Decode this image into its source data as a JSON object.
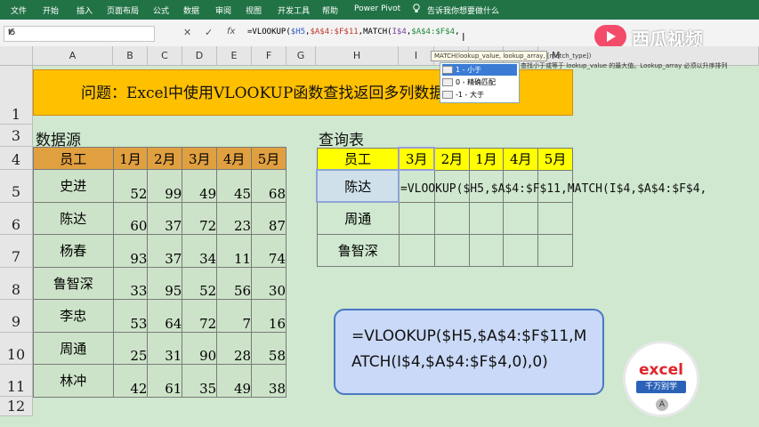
{
  "ribbon": {
    "tabs": [
      "文件",
      "开始",
      "插入",
      "页面布局",
      "公式",
      "数据",
      "审阅",
      "视图",
      "开发工具",
      "帮助",
      "Power Pivot"
    ],
    "tell_me": "告诉我你想要做什么"
  },
  "formula_bar": {
    "name_box": "I5",
    "cancel": "✕",
    "enter": "✓",
    "fx": "fx",
    "p1": "=VLOOKUP(",
    "p2": "$H5",
    "p3": ",",
    "p4": "$A$4:$F$11",
    "p5": ",MATCH(",
    "p6": "I$4",
    "p7": ",",
    "p8": "$A$4:$F$4",
    "p9": ","
  },
  "tooltip": {
    "text": "MATCH(lookup_value, lookup_array, [match_type])"
  },
  "autocomplete": {
    "items": [
      "1 - 小于",
      "0 - 精确匹配",
      "-1 - 大于"
    ],
    "description": "查找小于或等于 lookup_value 的最大值。Lookup_array 必须以升序排列"
  },
  "columns": [
    "A",
    "B",
    "C",
    "D",
    "E",
    "F",
    "G",
    "H",
    "I",
    "J",
    "K",
    "L",
    "M"
  ],
  "rows": [
    "1",
    "3",
    "4",
    "5",
    "6",
    "7",
    "8",
    "9",
    "10",
    "11",
    "12"
  ],
  "question": "问题：Excel中使用VLOOKUP函数查找返回多列数据",
  "source": {
    "title": "数据源",
    "headers": [
      "员工",
      "1月",
      "2月",
      "3月",
      "4月",
      "5月"
    ],
    "rows": [
      [
        "史进",
        "52",
        "99",
        "49",
        "45",
        "68"
      ],
      [
        "陈达",
        "60",
        "37",
        "72",
        "23",
        "87"
      ],
      [
        "杨春",
        "93",
        "37",
        "34",
        "11",
        "74"
      ],
      [
        "鲁智深",
        "33",
        "95",
        "52",
        "56",
        "30"
      ],
      [
        "李忠",
        "53",
        "64",
        "72",
        "7",
        "16"
      ],
      [
        "周通",
        "25",
        "31",
        "90",
        "28",
        "58"
      ],
      [
        "林冲",
        "42",
        "61",
        "35",
        "49",
        "38"
      ]
    ]
  },
  "lookup": {
    "title": "查询表",
    "headers": [
      "员工",
      "3月",
      "2月",
      "1月",
      "4月",
      "5月"
    ],
    "names": [
      "陈达",
      "周通",
      "鲁智深"
    ],
    "editing_text": "=VLOOKUP($H5,$A$4:$F$11,MATCH(I$4,$A$4:$F$4,"
  },
  "formula_box": {
    "line1": "=VLOOKUP($H5,$A$4:$F$11,M",
    "line2": "ATCH(I$4,$A$4:$F$4,0),0)"
  },
  "watermark": {
    "text": "西瓜视频"
  },
  "badge": {
    "line1": "excel",
    "line2": "千万别学",
    "line3": "A"
  },
  "colors": {
    "ribbon": "#217346",
    "banner": "#ffc000",
    "source_header": "#e0a040",
    "lookup_header": "#ffff00",
    "sheet_bg": "#cfe8cf"
  }
}
